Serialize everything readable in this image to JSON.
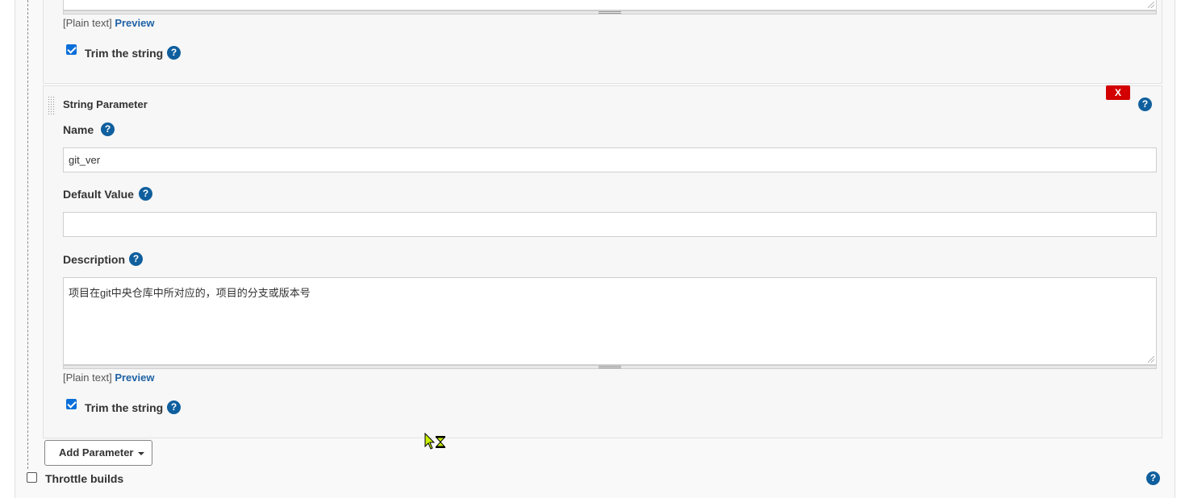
{
  "top_section": {
    "format_prefix": "[Plain text]",
    "preview_link": "Preview",
    "trim_label": "Trim the string",
    "trim_checked": true
  },
  "string_parameter": {
    "heading": "String Parameter",
    "delete_label": "X",
    "name_label": "Name",
    "name_value": "git_ver",
    "default_value_label": "Default Value",
    "default_value": "",
    "description_label": "Description",
    "description_value": "项目在git中央仓库中所对应的，项目的分支或版本号",
    "format_prefix": "[Plain text]",
    "preview_link": "Preview",
    "trim_label": "Trim the string",
    "trim_checked": true
  },
  "add_parameter_label": "Add Parameter",
  "throttle_builds": {
    "label": "Throttle builds",
    "checked": false
  },
  "help_glyph": "?",
  "icons": {
    "help": "help-question-icon",
    "drag": "drag-handle-icon",
    "caret": "caret-down-icon",
    "cursor": "busy-cursor-icon"
  },
  "colors": {
    "help_icon": "#0f5f9e",
    "delete_button": "#d20000",
    "link": "#1f62a5",
    "checkbox_checked": "#0a6fd8"
  }
}
